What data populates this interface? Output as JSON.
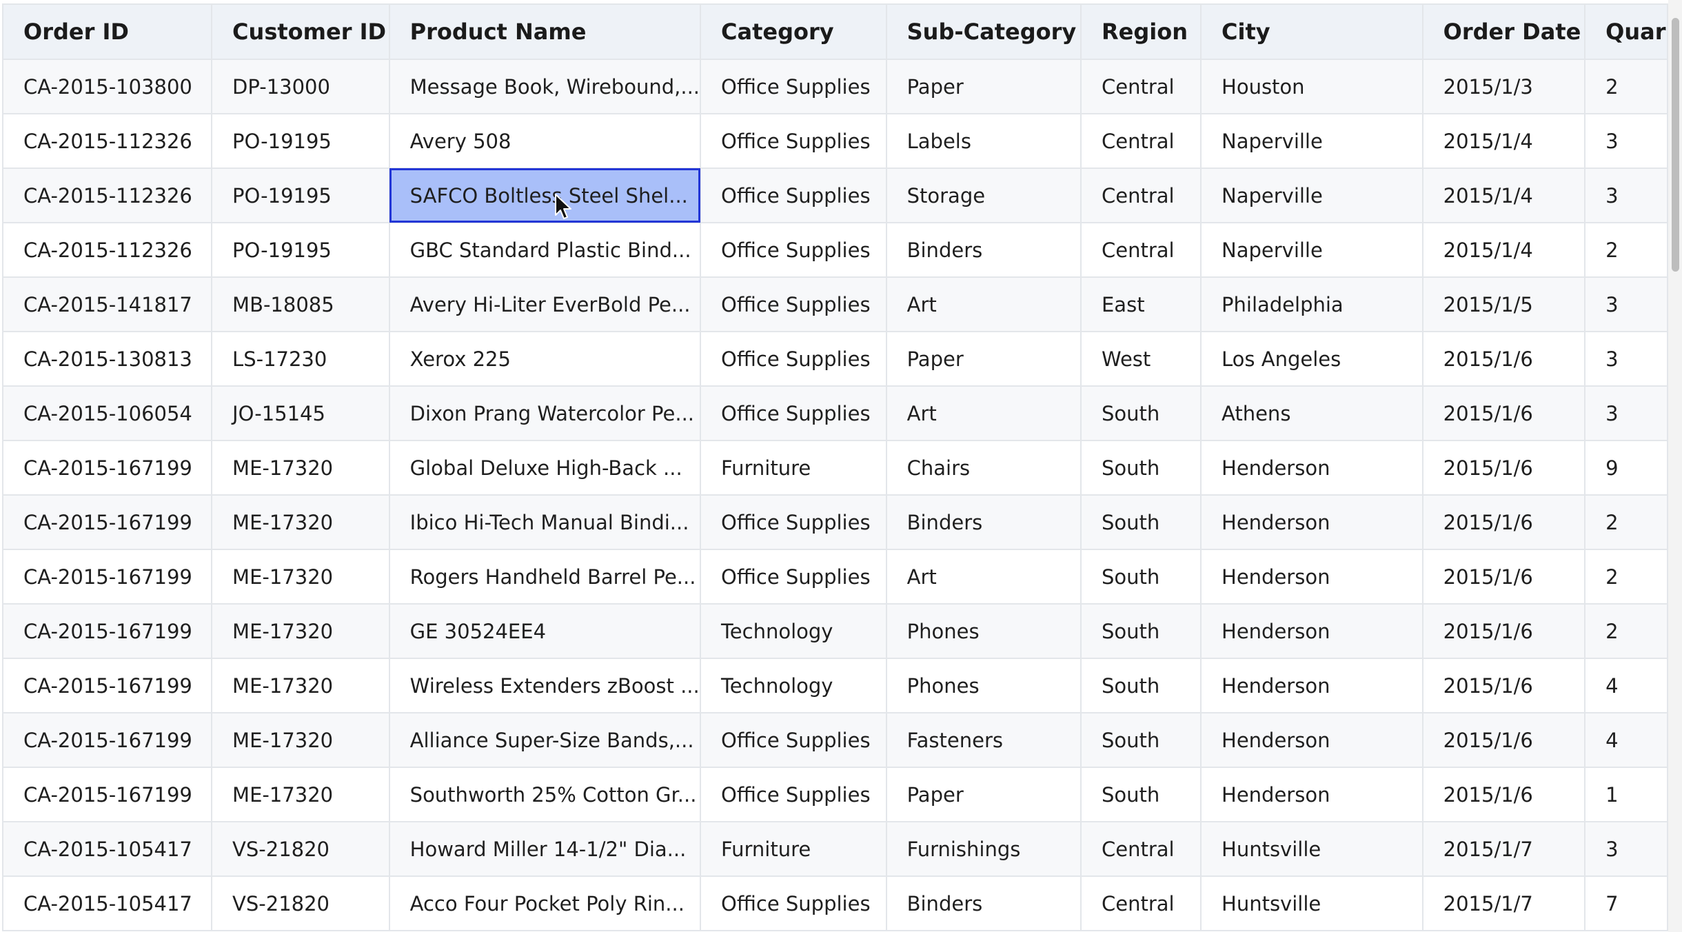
{
  "table": {
    "columns": [
      "Order ID",
      "Customer ID",
      "Product Name",
      "Category",
      "Sub-Category",
      "Region",
      "City",
      "Order Date",
      "Quar"
    ],
    "rows": [
      [
        "CA-2015-103800",
        "DP-13000",
        "Message Book, Wirebound,...",
        "Office Supplies",
        "Paper",
        "Central",
        "Houston",
        "2015/1/3",
        "2"
      ],
      [
        "CA-2015-112326",
        "PO-19195",
        "Avery 508",
        "Office Supplies",
        "Labels",
        "Central",
        "Naperville",
        "2015/1/4",
        "3"
      ],
      [
        "CA-2015-112326",
        "PO-19195",
        "SAFCO Boltless Steel Shel...",
        "Office Supplies",
        "Storage",
        "Central",
        "Naperville",
        "2015/1/4",
        "3"
      ],
      [
        "CA-2015-112326",
        "PO-19195",
        "GBC Standard Plastic Bind...",
        "Office Supplies",
        "Binders",
        "Central",
        "Naperville",
        "2015/1/4",
        "2"
      ],
      [
        "CA-2015-141817",
        "MB-18085",
        "Avery Hi-Liter EverBold Pe...",
        "Office Supplies",
        "Art",
        "East",
        "Philadelphia",
        "2015/1/5",
        "3"
      ],
      [
        "CA-2015-130813",
        "LS-17230",
        "Xerox 225",
        "Office Supplies",
        "Paper",
        "West",
        "Los Angeles",
        "2015/1/6",
        "3"
      ],
      [
        "CA-2015-106054",
        "JO-15145",
        "Dixon Prang Watercolor Pe...",
        "Office Supplies",
        "Art",
        "South",
        "Athens",
        "2015/1/6",
        "3"
      ],
      [
        "CA-2015-167199",
        "ME-17320",
        "Global Deluxe High-Back ...",
        "Furniture",
        "Chairs",
        "South",
        "Henderson",
        "2015/1/6",
        "9"
      ],
      [
        "CA-2015-167199",
        "ME-17320",
        "Ibico Hi-Tech Manual Bindi...",
        "Office Supplies",
        "Binders",
        "South",
        "Henderson",
        "2015/1/6",
        "2"
      ],
      [
        "CA-2015-167199",
        "ME-17320",
        "Rogers Handheld Barrel Pe...",
        "Office Supplies",
        "Art",
        "South",
        "Henderson",
        "2015/1/6",
        "2"
      ],
      [
        "CA-2015-167199",
        "ME-17320",
        "GE 30524EE4",
        "Technology",
        "Phones",
        "South",
        "Henderson",
        "2015/1/6",
        "2"
      ],
      [
        "CA-2015-167199",
        "ME-17320",
        "Wireless Extenders zBoost ...",
        "Technology",
        "Phones",
        "South",
        "Henderson",
        "2015/1/6",
        "4"
      ],
      [
        "CA-2015-167199",
        "ME-17320",
        "Alliance Super-Size Bands,...",
        "Office Supplies",
        "Fasteners",
        "South",
        "Henderson",
        "2015/1/6",
        "4"
      ],
      [
        "CA-2015-167199",
        "ME-17320",
        "Southworth 25% Cotton Gr...",
        "Office Supplies",
        "Paper",
        "South",
        "Henderson",
        "2015/1/6",
        "1"
      ],
      [
        "CA-2015-105417",
        "VS-21820",
        "Howard Miller 14-1/2\" Dia...",
        "Furniture",
        "Furnishings",
        "Central",
        "Huntsville",
        "2015/1/7",
        "3"
      ],
      [
        "CA-2015-105417",
        "VS-21820",
        "Acco Four Pocket Poly Rin...",
        "Office Supplies",
        "Binders",
        "Central",
        "Huntsville",
        "2015/1/7",
        "7"
      ]
    ],
    "selected_cell": {
      "row": 2,
      "col": 2
    }
  },
  "colors": {
    "header_bg": "#eef2f7",
    "selected_bg": "#a9bff9",
    "selected_border": "#2336d6",
    "grid_line": "#e3e6ea"
  },
  "icons": {
    "cursor": "mouse-pointer-icon"
  }
}
